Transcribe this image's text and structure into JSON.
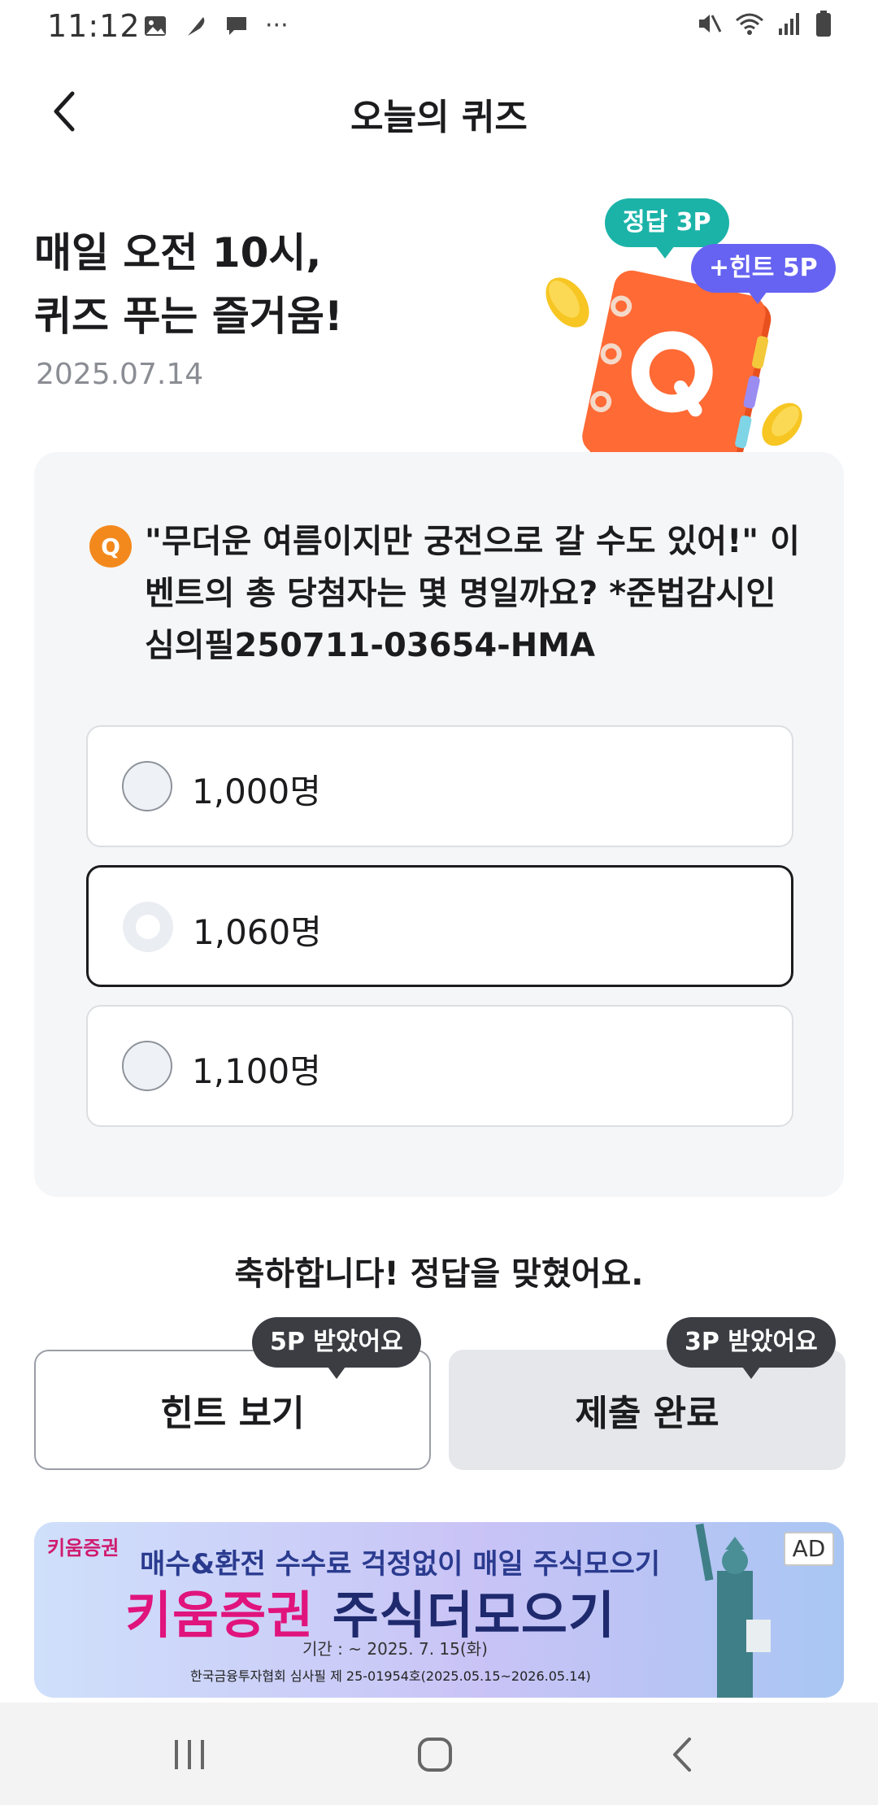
{
  "status_bar": {
    "time": "11:12",
    "more_dots": "···"
  },
  "header": {
    "title": "오늘의 퀴즈"
  },
  "hero": {
    "title_line1": "매일 오전 10시,",
    "title_line2": "퀴즈 푸는 즐거움!",
    "date": "2025.07.14",
    "bubble_answer": "정답 3P",
    "bubble_hint": "+힌트 5P",
    "illustration_letter": "Q"
  },
  "quiz": {
    "badge": "Q",
    "question_line1": "\"무더운 여름이지만 궁전으로 갈 수도 있어!\" 이",
    "question_line2": "벤트의 총 당첨자는 몇 명일까요? *준법감시인",
    "question_line3": "심의필250711-03654-HMA",
    "options": [
      {
        "label": "1,000명",
        "selected": false
      },
      {
        "label": "1,060명",
        "selected": true
      },
      {
        "label": "1,100명",
        "selected": false
      }
    ]
  },
  "result": {
    "message": "축하합니다! 정답을 맞혔어요."
  },
  "actions": {
    "hint_label": "힌트 보기",
    "hint_tag": "5P 받았어요",
    "submit_label": "제출 완료",
    "submit_tag": "3P 받았어요"
  },
  "ad": {
    "logo": "키움증권",
    "tag": "AD",
    "line1": "매수&환전 수수료 걱정없이 매일 주식모으기",
    "line2_brand": "키움증권",
    "line2_product": "주식더모으기",
    "line3": "기간 : ~ 2025. 7. 15(화)",
    "line4": "한국금융투자협회 심사필 제 25-01954호(2025.05.15~2026.05.14)"
  },
  "colors": {
    "accent_orange": "#f3891d",
    "bubble_teal": "#1bb3a8",
    "bubble_purple": "#6663f2",
    "ad_pink": "#e0147c"
  }
}
